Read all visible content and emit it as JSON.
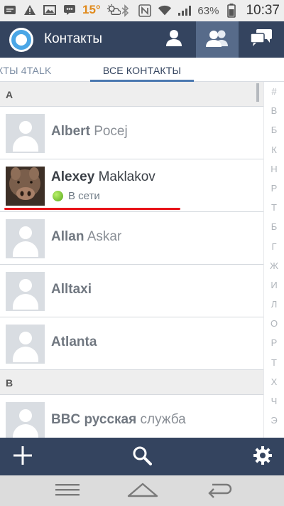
{
  "statusbar": {
    "temperature": "15°",
    "battery_percent": "63%",
    "time": "10:37",
    "icons": [
      "sms-icon",
      "warning-icon",
      "image-icon",
      "chat-icon",
      "weather-icon",
      "bluetooth-icon",
      "nfc-icon",
      "wifi-icon",
      "signal-icon",
      "battery-icon"
    ]
  },
  "app": {
    "title": "Контакты",
    "header_buttons": [
      {
        "name": "single-contact-icon",
        "active": false
      },
      {
        "name": "contacts-group-icon",
        "active": true
      },
      {
        "name": "chat-bubbles-icon",
        "active": false
      }
    ]
  },
  "tabs": [
    {
      "label": "КТЫ 4TALK",
      "active": false
    },
    {
      "label": "ВСЕ КОНТАКТЫ",
      "active": true
    }
  ],
  "sections": [
    {
      "letter": "A",
      "contacts": [
        {
          "first": "Albert",
          "last": "Pocej",
          "photo": false,
          "status": ""
        },
        {
          "first": "Alexey",
          "last": "Maklakov",
          "photo": true,
          "status": "В сети"
        },
        {
          "first": "Allan",
          "last": "Askar",
          "photo": false,
          "status": ""
        },
        {
          "first": "Alltaxi",
          "last": "",
          "photo": false,
          "status": ""
        },
        {
          "first": "Atlanta",
          "last": "",
          "photo": false,
          "status": ""
        }
      ]
    },
    {
      "letter": "B",
      "contacts": [
        {
          "first": "BBC русская",
          "last": "служба",
          "photo": false,
          "status": ""
        }
      ]
    }
  ],
  "alphabet_index": [
    "#",
    "В",
    "Б",
    "К",
    "Н",
    "Р",
    "Т",
    "Б",
    "Г",
    "Ж",
    "И",
    "Л",
    "О",
    "Р",
    "Т",
    "Х",
    "Ч",
    "Э"
  ],
  "bottombar": {
    "buttons": [
      "add-icon",
      "search-icon",
      "settings-gear-icon"
    ]
  },
  "navbar": {
    "buttons": [
      "menu-icon",
      "home-icon",
      "back-icon"
    ]
  }
}
